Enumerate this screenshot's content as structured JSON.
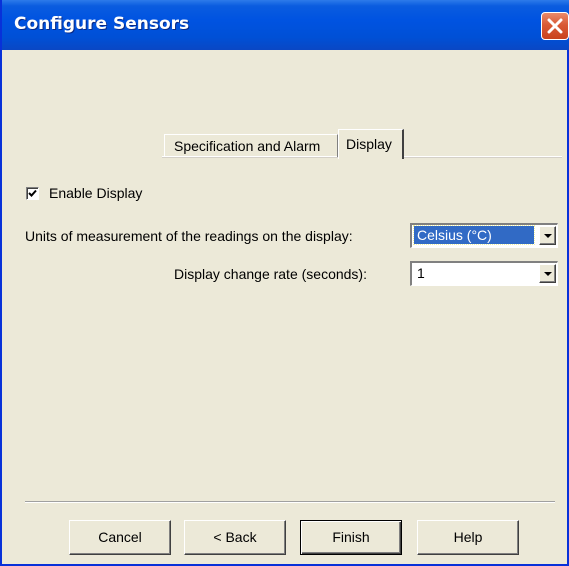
{
  "window": {
    "title": "Configure Sensors"
  },
  "tabs": [
    {
      "label": "Specification and Alarm",
      "selected": false
    },
    {
      "label": "Display",
      "selected": true
    }
  ],
  "display": {
    "enable_display_label": "Enable Display",
    "enable_display_checked": true,
    "units_label": "Units of measurement of the readings on the display:",
    "units_value": "Celsius (°C)",
    "rate_label": "Display change rate (seconds):",
    "rate_value": "1"
  },
  "buttons": {
    "cancel": "Cancel",
    "back": "< Back",
    "finish": "Finish",
    "help": "Help"
  },
  "icons": {
    "close": "close-icon",
    "checkmark": "checkmark-icon",
    "dropdown": "chevron-down-icon"
  },
  "colors": {
    "titlebar": "#0053e1",
    "dialog_bg": "#ece9d8",
    "close_button": "#d95a36",
    "selection": "#316ac5"
  }
}
